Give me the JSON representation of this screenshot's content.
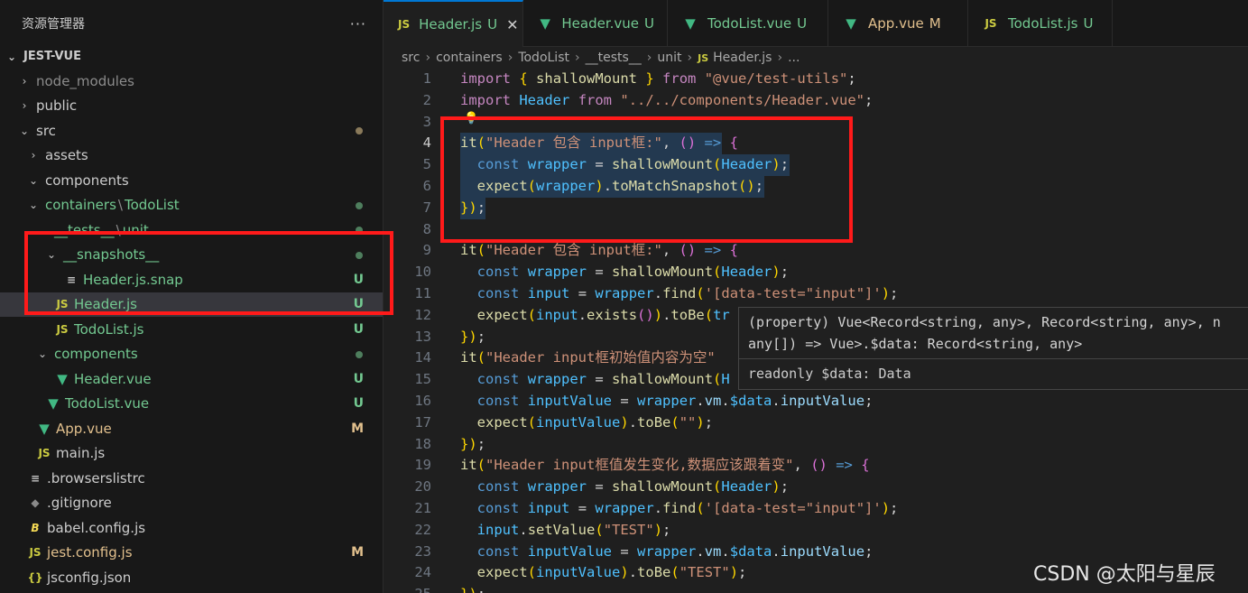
{
  "explorer": {
    "title": "资源管理器",
    "more": "···",
    "root": "JEST-VUE",
    "items": [
      {
        "label": "node_modules",
        "type": "folder",
        "open": false,
        "depth": 1,
        "color": "dim"
      },
      {
        "label": "public",
        "type": "folder",
        "open": false,
        "depth": 1,
        "color": "plain"
      },
      {
        "label": "src",
        "type": "folder",
        "open": true,
        "depth": 1,
        "color": "plain",
        "dot": "mod"
      },
      {
        "label": "assets",
        "type": "folder",
        "open": false,
        "depth": 2,
        "color": "plain"
      },
      {
        "label": "components",
        "type": "folder",
        "open": true,
        "depth": 2,
        "color": "plain"
      },
      {
        "label": "containers",
        "label2": "TodoList",
        "type": "folder",
        "open": true,
        "depth": 2,
        "color": "green",
        "dot": "green"
      },
      {
        "label": "__tests__",
        "label2": "unit",
        "type": "folder",
        "open": true,
        "depth": 3,
        "color": "green",
        "dot": "green"
      },
      {
        "label": "__snapshots__",
        "type": "folder",
        "open": true,
        "depth": 4,
        "color": "green",
        "dot": "green"
      },
      {
        "label": "Header.js.snap",
        "type": "lines",
        "depth": 5,
        "color": "green",
        "badge": "U"
      },
      {
        "label": "Header.js",
        "type": "js",
        "depth": 4,
        "color": "green",
        "badge": "U",
        "selected": true
      },
      {
        "label": "TodoList.js",
        "type": "js",
        "depth": 4,
        "color": "green",
        "badge": "U"
      },
      {
        "label": "components",
        "type": "folder",
        "open": true,
        "depth": 3,
        "color": "green",
        "dot": "green"
      },
      {
        "label": "Header.vue",
        "type": "vue",
        "depth": 4,
        "color": "green",
        "badge": "U"
      },
      {
        "label": "TodoList.vue",
        "type": "vue",
        "depth": 3,
        "color": "green",
        "badge": "U"
      },
      {
        "label": "App.vue",
        "type": "vue",
        "depth": 2,
        "color": "mod",
        "badge": "M"
      },
      {
        "label": "main.js",
        "type": "js",
        "depth": 2,
        "color": "plain"
      },
      {
        "label": ".browserslistrc",
        "type": "lines",
        "depth": 1,
        "color": "plain"
      },
      {
        "label": ".gitignore",
        "type": "git",
        "depth": 1,
        "color": "plain"
      },
      {
        "label": "babel.config.js",
        "type": "babel",
        "depth": 1,
        "color": "plain"
      },
      {
        "label": "jest.config.js",
        "type": "js",
        "depth": 1,
        "color": "mod",
        "badge": "M"
      },
      {
        "label": "jsconfig.json",
        "type": "braces",
        "depth": 1,
        "color": "plain"
      }
    ]
  },
  "tabs": [
    {
      "icon": "JS",
      "name": "Header.js",
      "badge": "U",
      "active": true,
      "close": "✕",
      "color": "green"
    },
    {
      "icon": "vue",
      "name": "Header.vue",
      "badge": "U",
      "color": "green"
    },
    {
      "icon": "vue",
      "name": "TodoList.vue",
      "badge": "U",
      "color": "green"
    },
    {
      "icon": "vue",
      "name": "App.vue",
      "badge": "M",
      "color": "mod"
    },
    {
      "icon": "JS",
      "name": "TodoList.js",
      "badge": "U",
      "color": "green"
    }
  ],
  "breadcrumb": {
    "parts": [
      "src",
      "containers",
      "TodoList",
      "__tests__",
      "unit"
    ],
    "file_icon": "JS",
    "file": "Header.js",
    "tail": "..."
  },
  "code": {
    "current_line": 4,
    "lines": [
      "import { shallowMount } from \"@vue/test-utils\";",
      "import Header from \"../../components/Header.vue\";",
      "",
      "it(\"Header 包含 input框:\", () => {",
      "  const wrapper = shallowMount(Header);",
      "  expect(wrapper).toMatchSnapshot();",
      "});",
      "",
      "it(\"Header 包含 input框:\", () => {",
      "  const wrapper = shallowMount(Header);",
      "  const input = wrapper.find('[data-test=\"input\"]');",
      "  expect(input.exists()).toBe(tr",
      "});",
      "it(\"Header input框初始值内容为空\"",
      "  const wrapper = shallowMount(H",
      "  const inputValue = wrapper.vm.$data.inputValue;",
      "  expect(inputValue).toBe(\"\");",
      "});",
      "it(\"Header input框值发生变化,数据应该跟着变\", () => {",
      "  const wrapper = shallowMount(Header);",
      "  const input = wrapper.find('[data-test=\"input\"]');",
      "  input.setValue(\"TEST\");",
      "  const inputValue = wrapper.vm.$data.inputValue;",
      "  expect(inputValue).toBe(\"TEST\");",
      "});"
    ]
  },
  "hover": {
    "line1": "(property) Vue<Record<string, any>, Record<string, any>, n",
    "line2": "any[]) => Vue>.$data: Record<string, any>",
    "line3": "readonly $data: Data"
  },
  "watermark": "CSDN @太阳与星辰",
  "colors": {
    "accent": "#0078d4",
    "highlight_box": "#ff1a1a",
    "untracked": "#73c991",
    "modified": "#e2c08d"
  }
}
